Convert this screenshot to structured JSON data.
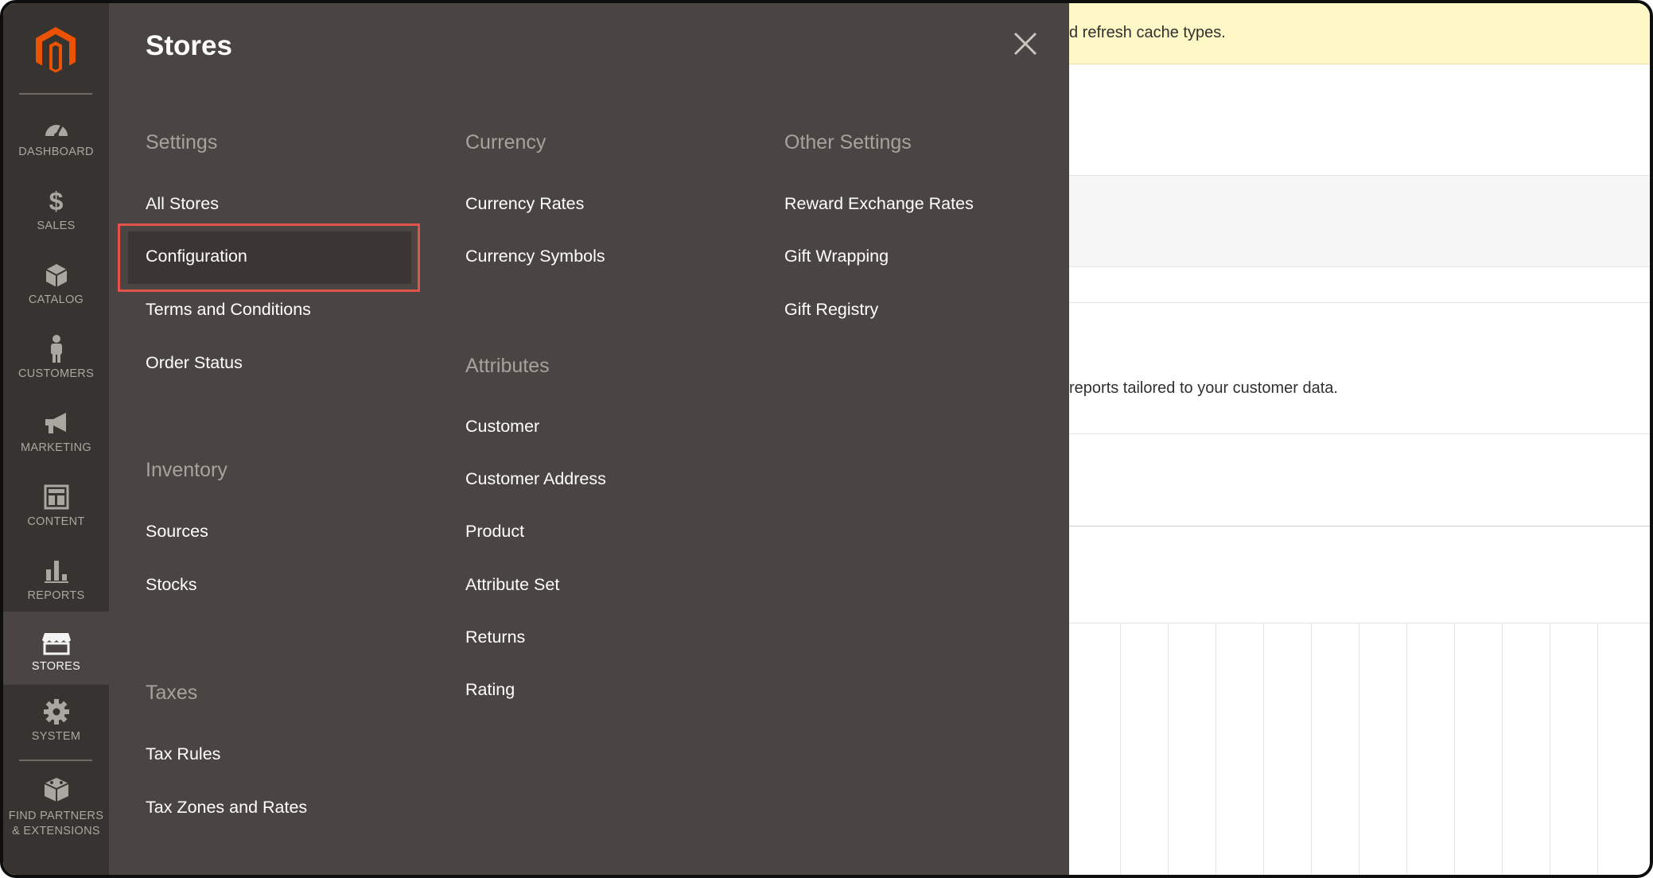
{
  "sidebar": {
    "items": [
      {
        "label": "DASHBOARD",
        "icon": "dashboard-icon"
      },
      {
        "label": "SALES",
        "icon": "dollar-icon"
      },
      {
        "label": "CATALOG",
        "icon": "box-icon"
      },
      {
        "label": "CUSTOMERS",
        "icon": "person-icon"
      },
      {
        "label": "MARKETING",
        "icon": "megaphone-icon"
      },
      {
        "label": "CONTENT",
        "icon": "layout-icon"
      },
      {
        "label": "REPORTS",
        "icon": "bar-chart-icon"
      },
      {
        "label": "STORES",
        "icon": "store-icon"
      },
      {
        "label": "SYSTEM",
        "icon": "gear-icon"
      },
      {
        "label_line1": "FIND PARTNERS",
        "label_line2": "& EXTENSIONS",
        "icon": "blocks-icon"
      }
    ],
    "active": "STORES"
  },
  "flyout": {
    "title": "Stores",
    "settings": {
      "title": "Settings",
      "links": [
        "All Stores",
        "Configuration",
        "Terms and Conditions",
        "Order Status"
      ]
    },
    "inventory": {
      "title": "Inventory",
      "links": [
        "Sources",
        "Stocks"
      ]
    },
    "taxes": {
      "title": "Taxes",
      "links": [
        "Tax Rules",
        "Tax Zones and Rates"
      ]
    },
    "currency": {
      "title": "Currency",
      "links": [
        "Currency Rates",
        "Currency Symbols"
      ]
    },
    "attributes": {
      "title": "Attributes",
      "links": [
        "Customer",
        "Customer Address",
        "Product",
        "Attribute Set",
        "Returns",
        "Rating"
      ]
    },
    "other": {
      "title": "Other Settings",
      "links": [
        "Reward Exchange Rates",
        "Gift Wrapping",
        "Gift Registry"
      ]
    },
    "highlighted": "Configuration"
  },
  "background": {
    "notice_text": "d refresh cache types.",
    "body_text": "reports tailored to your customer data."
  },
  "colors": {
    "accent": "#eb5202",
    "highlight": "#e2524a",
    "flyout_bg": "#4a4542",
    "sidebar_bg": "#373330",
    "notice_bg": "#fdf8c5"
  }
}
